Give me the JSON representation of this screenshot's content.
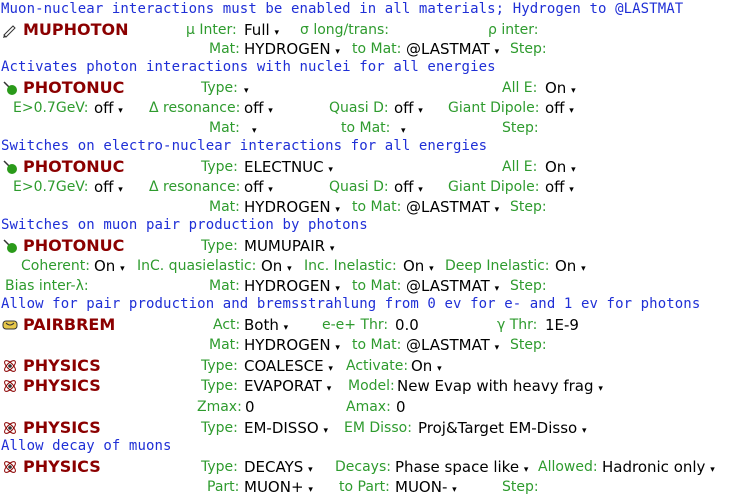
{
  "muphoton": {
    "comment": "Muon-nuclear interactions must be enabled in all materials; Hydrogen to @LASTMAT",
    "card": "MUPHOTON",
    "mu_inter_label": "μ Inter:",
    "mu_inter_value": "Full",
    "sigma_label": "σ long/trans:",
    "rho_label": "ρ inter:",
    "mat_label": "Mat:",
    "mat_value": "HYDROGEN",
    "tomat_label": "to Mat:",
    "tomat_value": "@LASTMAT",
    "step_label": "Step:"
  },
  "photonuc1": {
    "comment": "Activates photon interactions with nuclei for all energies",
    "card": "PHOTONUC",
    "type_label": "Type:",
    "type_value": "",
    "alle_label": "All E:",
    "alle_value": "On",
    "e07_label": "E>0.7GeV:",
    "e07_value": "off",
    "delta_label": "Δ resonance:",
    "delta_value": "off",
    "quasi_label": "Quasi D:",
    "quasi_value": "off",
    "giant_label": "Giant Dipole:",
    "giant_value": "off",
    "mat_label": "Mat:",
    "tomat_label": "to Mat:",
    "step_label": "Step:"
  },
  "photonuc2": {
    "comment": "Switches on electro-nuclear interactions for all energies",
    "card": "PHOTONUC",
    "type_label": "Type:",
    "type_value": "ELECTNUC",
    "alle_label": "All E:",
    "alle_value": "On",
    "e07_label": "E>0.7GeV:",
    "e07_value": "off",
    "delta_label": "Δ resonance:",
    "delta_value": "off",
    "quasi_label": "Quasi D:",
    "quasi_value": "off",
    "giant_label": "Giant Dipole:",
    "giant_value": "off",
    "mat_label": "Mat:",
    "mat_value": "HYDROGEN",
    "tomat_label": "to Mat:",
    "tomat_value": "@LASTMAT",
    "step_label": "Step:"
  },
  "photonuc3": {
    "comment": "Switches on muon pair production by photons",
    "card": "PHOTONUC",
    "type_label": "Type:",
    "type_value": "MUMUPAIR",
    "coherent_label": "Coherent:",
    "coherent_value": "On",
    "incqe_label": "InC. quasielastic:",
    "incqe_value": "On",
    "incin_label": "Inc. Inelastic:",
    "incin_value": "On",
    "deep_label": "Deep Inelastic:",
    "deep_value": "On",
    "bias_label": "Bias inter-λ:",
    "mat_label": "Mat:",
    "mat_value": "HYDROGEN",
    "tomat_label": "to Mat:",
    "tomat_value": "@LASTMAT",
    "step_label": "Step:"
  },
  "pairbrem": {
    "comment": "Allow for pair production and bremsstrahlung from 0 ev for e- and 1 ev for photons",
    "card": "PAIRBREM",
    "act_label": "Act:",
    "act_value": "Both",
    "ee_label": "e-e+ Thr:",
    "ee_value": "0.0",
    "gamma_label": "γ Thr:",
    "gamma_value": "1E-9",
    "mat_label": "Mat:",
    "mat_value": "HYDROGEN",
    "tomat_label": "to Mat:",
    "tomat_value": "@LASTMAT",
    "step_label": "Step:"
  },
  "physics1": {
    "card": "PHYSICS",
    "type_label": "Type:",
    "type_value": "COALESCE",
    "activate_label": "Activate:",
    "activate_value": "On"
  },
  "physics2": {
    "card": "PHYSICS",
    "type_label": "Type:",
    "type_value": "EVAPORAT",
    "model_label": "Model:",
    "model_value": "New Evap with heavy frag",
    "zmax_label": "Zmax:",
    "zmax_value": "0",
    "amax_label": "Amax:",
    "amax_value": "0"
  },
  "physics3": {
    "card": "PHYSICS",
    "type_label": "Type:",
    "type_value": "EM-DISSO",
    "emdisso_label": "EM Disso:",
    "emdisso_value": "Proj&Target EM-Disso"
  },
  "physics4": {
    "comment": "Allow decay of muons",
    "card": "PHYSICS",
    "type_label": "Type:",
    "type_value": "DECAYS",
    "decays_label": "Decays:",
    "decays_value": "Phase space like",
    "allowed_label": "Allowed:",
    "allowed_value": "Hadronic only",
    "part_label": "Part:",
    "part_value": "MUON+",
    "topart_label": "to Part:",
    "topart_value": "MUON-",
    "step_label": "Step:"
  },
  "arrow_glyph": "▾",
  "colors": {
    "comment": "#1f2fd6",
    "card": "#8b0000",
    "label": "#2e9b2e",
    "value": "#000000"
  },
  "icons": {
    "muphoton": "pencil-icon",
    "photonuc": "green-ball-icon",
    "pairbrem": "scroll-icon",
    "physics": "atom-icon"
  }
}
